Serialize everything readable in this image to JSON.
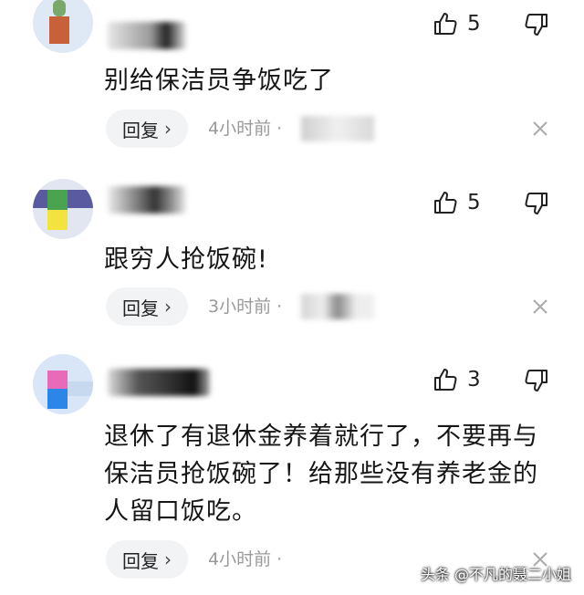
{
  "comments": [
    {
      "text": "别给保洁员争饭吃了",
      "likes": "5",
      "reply_label": "回复",
      "time": "4小时前 ·"
    },
    {
      "text": "跟穷人抢饭碗!",
      "likes": "5",
      "reply_label": "回复",
      "time": "3小时前 ·"
    },
    {
      "text": "退休了有退休金养着就行了，不要再与保洁员抢饭碗了！给那些没有养老金的人留口饭吃。",
      "likes": "3",
      "reply_label": "回复",
      "time": "4小时前 ·"
    }
  ],
  "icons": {
    "like": "thumbs-up-icon",
    "dislike": "thumbs-down-icon",
    "close": "close-icon",
    "reply_chevron": "chevron-right-icon"
  },
  "reply_chevron_glyph": "›",
  "watermark": "头条 @不凡的聂二小姐",
  "colors": {
    "reply_bg": "#f2f3f5",
    "secondary_text": "#9a9a9a",
    "primary_text": "#161616"
  }
}
